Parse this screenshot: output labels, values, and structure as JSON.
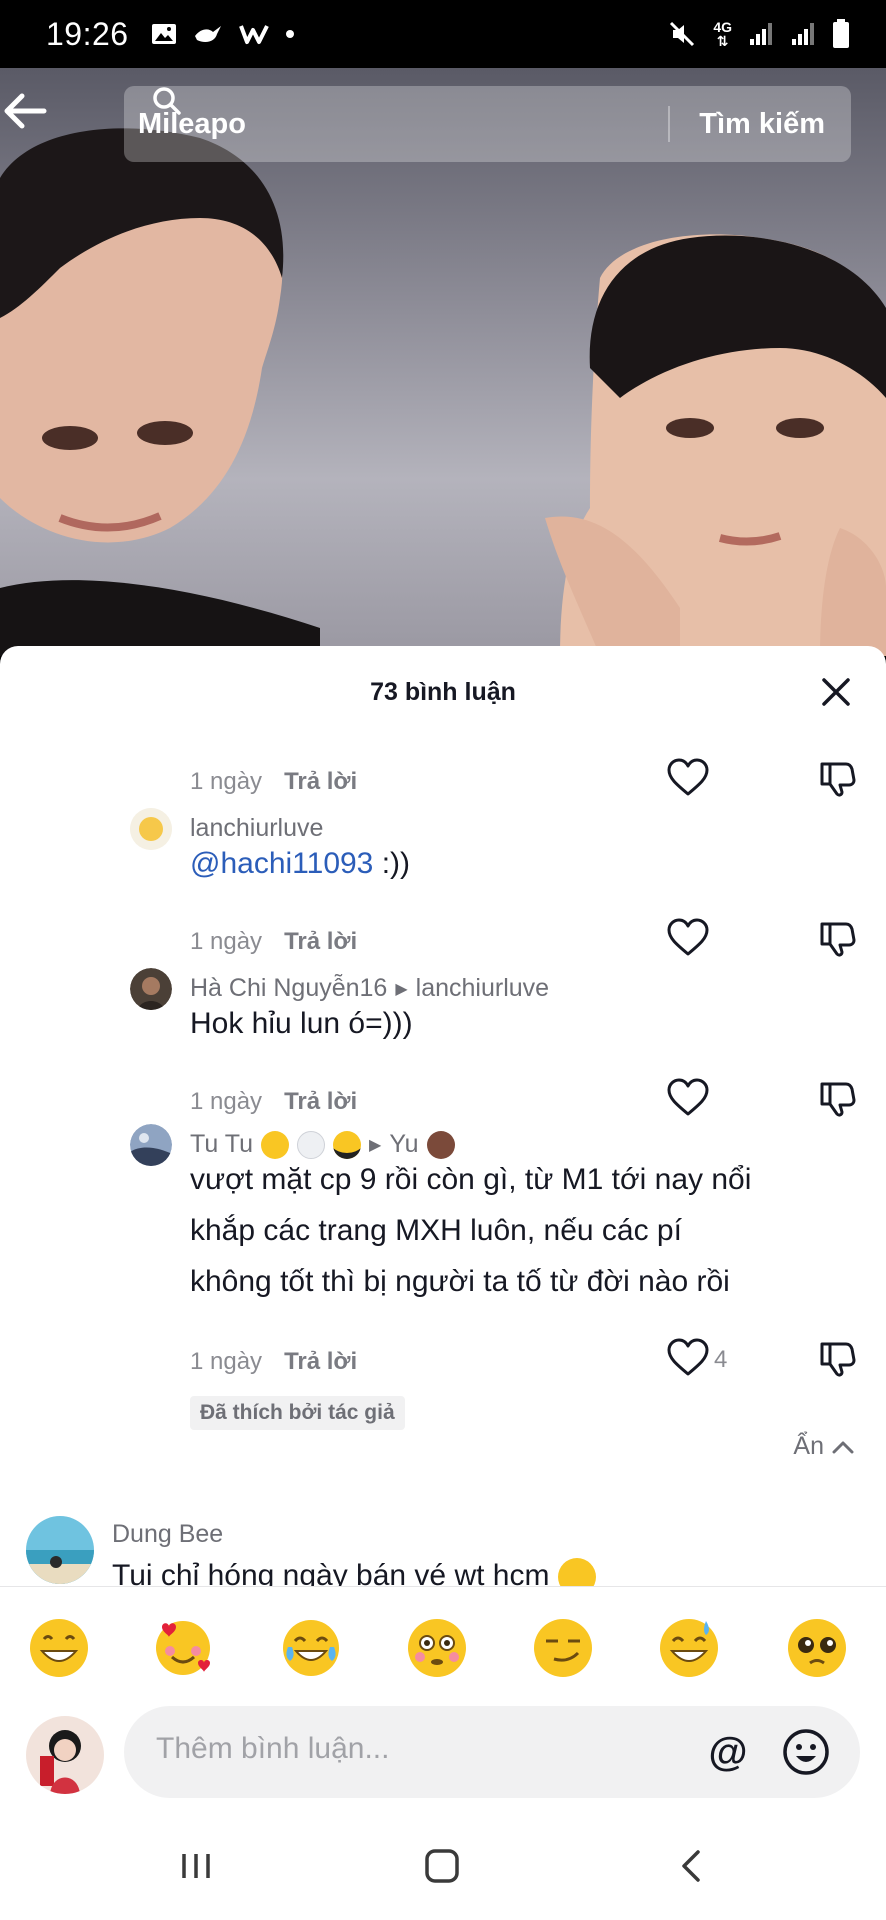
{
  "status_bar": {
    "time": "19:26",
    "network": "4G",
    "icons": [
      "image-icon",
      "bird-icon",
      "w-app-icon",
      "dot-icon",
      "mute-icon",
      "signal-icon",
      "signal-icon",
      "battery-icon"
    ]
  },
  "search": {
    "query": "Mileapo",
    "button_label": "Tìm kiếm"
  },
  "sheet": {
    "title": "73 bình luận"
  },
  "comments": [
    {
      "time": "1 ngày",
      "reply_label": "Trả lời"
    },
    {
      "username": "lanchiurluve",
      "mention": "@hachi11093",
      "text": " :))",
      "time": "1 ngày",
      "reply_label": "Trả lời"
    },
    {
      "username": "Hà Chi Nguyễn16",
      "reply_to": "lanchiurluve",
      "text": "Hok hỉu lun ó=)))",
      "time": "1 ngày",
      "reply_label": "Trả lời"
    },
    {
      "username": "Tu Tu",
      "reply_to": "Yu",
      "text_lines": [
        "vượt mặt cp 9 rồi còn gì, từ M1 tới nay nổi",
        "khắp các trang MXH luôn, nếu các pí",
        "không tốt thì bị người ta tố từ đời nào rồi"
      ],
      "time": "1 ngày",
      "reply_label": "Trả lời",
      "likes": "4",
      "badge": "Đã thích bởi tác giả"
    }
  ],
  "hide_label": "Ẩn",
  "top_comment": {
    "username": "Dung Bee",
    "text": "Tui chỉ hóng ngày bán vé wt hcm"
  },
  "emoji_bar": [
    "grinning",
    "smiling-hearts",
    "tears-of-joy",
    "flushed",
    "smirk",
    "sweat-smile",
    "pleading"
  ],
  "input": {
    "placeholder": "Thêm bình luận..."
  },
  "colors": {
    "mention": "#2b5db9",
    "secondary_text": "#6e6f76",
    "emoji_yellow": "#f9c623"
  }
}
